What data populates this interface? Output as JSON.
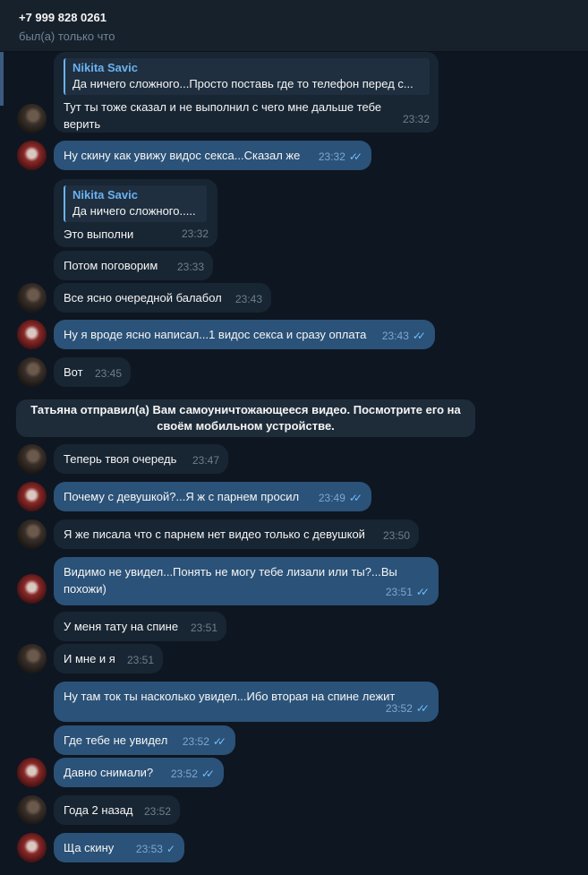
{
  "header": {
    "name": "+7 999 828 0261",
    "status": "был(а) только что"
  },
  "messages": [
    {
      "side": "in",
      "reply_name": "Nikita Savic",
      "reply_text": "Да ничего сложного...Просто поставь где то телефон перед с...",
      "text": "Тут ты тоже сказал и не выполнил с чего мне дальше тебе верить",
      "time": "23:32"
    },
    {
      "side": "out",
      "text": "Ну скину как увижу видос секса...Сказал же",
      "time": "23:32",
      "read": true
    },
    {
      "side": "in",
      "reply_name": "Nikita Savic",
      "reply_text": "Да ничего сложного.....",
      "text": "Это выполни",
      "time": "23:32"
    },
    {
      "side": "in",
      "text": "Потом поговорим",
      "time": "23:33"
    },
    {
      "side": "in",
      "text": "Все ясно очередной балабол",
      "time": "23:43"
    },
    {
      "side": "out",
      "text": "Ну я вроде ясно написал...1 видос секса и сразу оплата",
      "time": "23:43",
      "read": true
    },
    {
      "side": "in",
      "text": "Вот",
      "time": "23:45"
    },
    {
      "side": "in",
      "text": "Теперь твоя очередь",
      "time": "23:47"
    },
    {
      "side": "out",
      "text": "Почему с девушкой?...Я ж с парнем просил",
      "time": "23:49",
      "read": true
    },
    {
      "side": "in",
      "text": "Я же писала что с парнем нет видео только с девушкой",
      "time": "23:50"
    },
    {
      "side": "out",
      "text": "Видимо не увидел...Понять не могу тебе лизали или ты?...Вы похожи)",
      "time": "23:51",
      "read": true
    },
    {
      "side": "in",
      "text": "У меня тату на спине",
      "time": "23:51"
    },
    {
      "side": "in",
      "text": "И мне и я",
      "time": "23:51"
    },
    {
      "side": "out",
      "text": "Ну там ток ты насколько увидел...Ибо вторая на спине лежит",
      "time": "23:52",
      "read": true
    },
    {
      "side": "out",
      "text": "Где тебе не увидел",
      "time": "23:52",
      "read": true
    },
    {
      "side": "out",
      "text": "Давно снимали?",
      "time": "23:52",
      "read": true
    },
    {
      "side": "in",
      "text": "Года 2 назад",
      "time": "23:52"
    },
    {
      "side": "out",
      "text": "Ща скину",
      "time": "23:53",
      "read": false
    }
  ],
  "service_message": "Татьяна отправил(а) Вам самоуничтожающееся видео. Посмотрите его на своём мобильном устройстве.",
  "icons": {
    "double_check": "✓✓",
    "single_check": "✓"
  },
  "colors": {
    "background": "#0e1621",
    "incoming": "#182533",
    "outgoing": "#2b5278",
    "accent": "#6ab2f2"
  }
}
